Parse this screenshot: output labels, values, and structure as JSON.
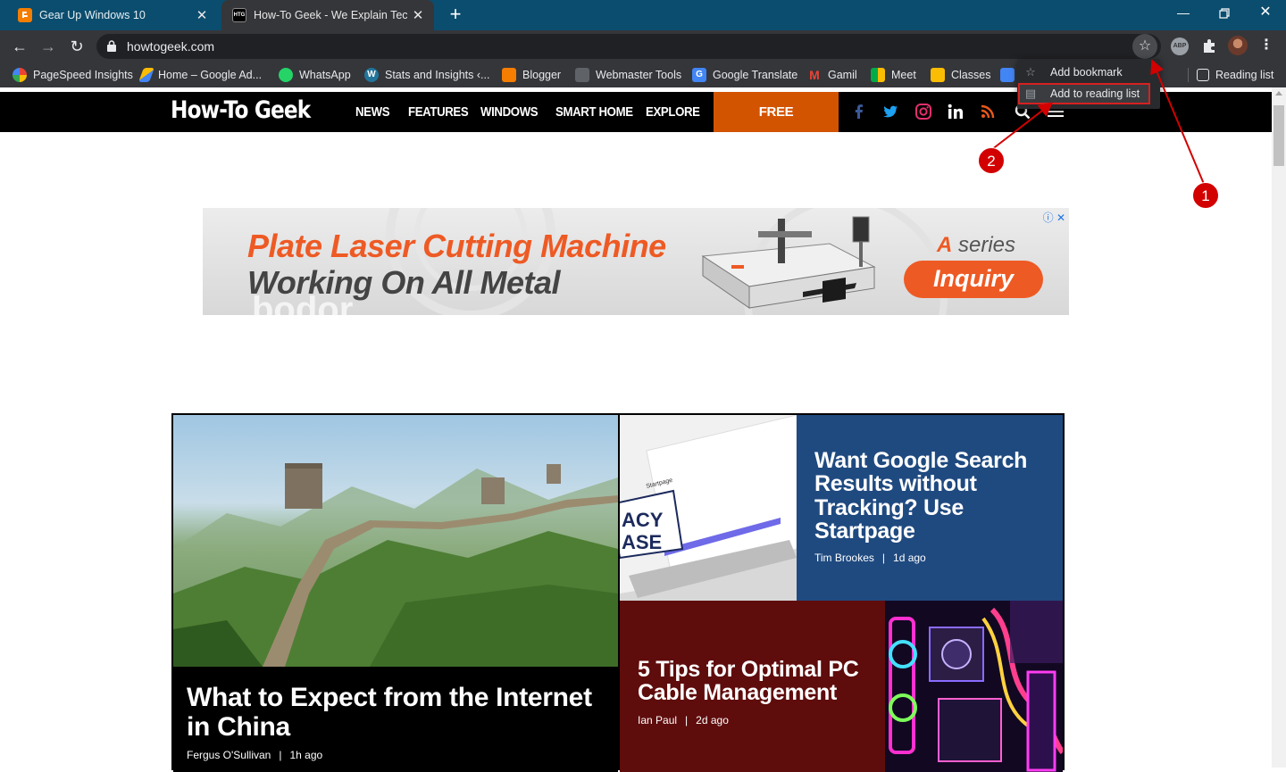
{
  "browser": {
    "tabs": [
      {
        "title": "Gear Up Windows 10",
        "favicon": "blogger-icon",
        "active": false
      },
      {
        "title": "How-To Geek - We Explain Technology",
        "favicon": "htg-icon",
        "favicon_text": "HTG",
        "active": true
      }
    ],
    "address": "howtogeek.com",
    "bookmarks": [
      "PageSpeed Insights",
      "Home – Google Ad...",
      "WhatsApp",
      "Stats and Insights ‹...",
      "Blogger",
      "Webmaster Tools",
      "Google Translate",
      "Gamil",
      "Meet",
      "Classes"
    ],
    "reading_list": "Reading list",
    "popup": {
      "add_bookmark": "Add bookmark",
      "add_reading_list": "Add to reading list"
    },
    "colors": {
      "tabstrip": "#0b4d6e",
      "toolbar": "#35363a",
      "highlight": "#d62121"
    }
  },
  "site": {
    "logo": "How-To Geek",
    "nav": [
      "NEWS",
      "FEATURES",
      "WINDOWS",
      "SMART HOME",
      "EXPLORE"
    ],
    "newsletter": "FREE NEWSLETTER",
    "accent": "#d35400"
  },
  "ad": {
    "headline1": "Plate Laser Cutting Machine",
    "headline2": "Working On All Metal",
    "series_a": "A",
    "series_rest": " series",
    "cta": "Inquiry",
    "watermark": "bodor"
  },
  "articles": {
    "main": {
      "title": "What to Expect from the Internet in China",
      "author": "Fergus O'Sullivan",
      "time": "1h ago"
    },
    "a": {
      "title": "Want Google Search Results without Tracking? Use Startpage",
      "author": "Tim Brookes",
      "time": "1d ago",
      "image_text_1": "ACY",
      "image_text_2": "ASE",
      "image_brand": "Startpage"
    },
    "b": {
      "title": "5 Tips for Optimal PC Cable Management",
      "author": "Ian Paul",
      "time": "2d ago"
    }
  },
  "annotations": {
    "marker1": "1",
    "marker2": "2"
  }
}
